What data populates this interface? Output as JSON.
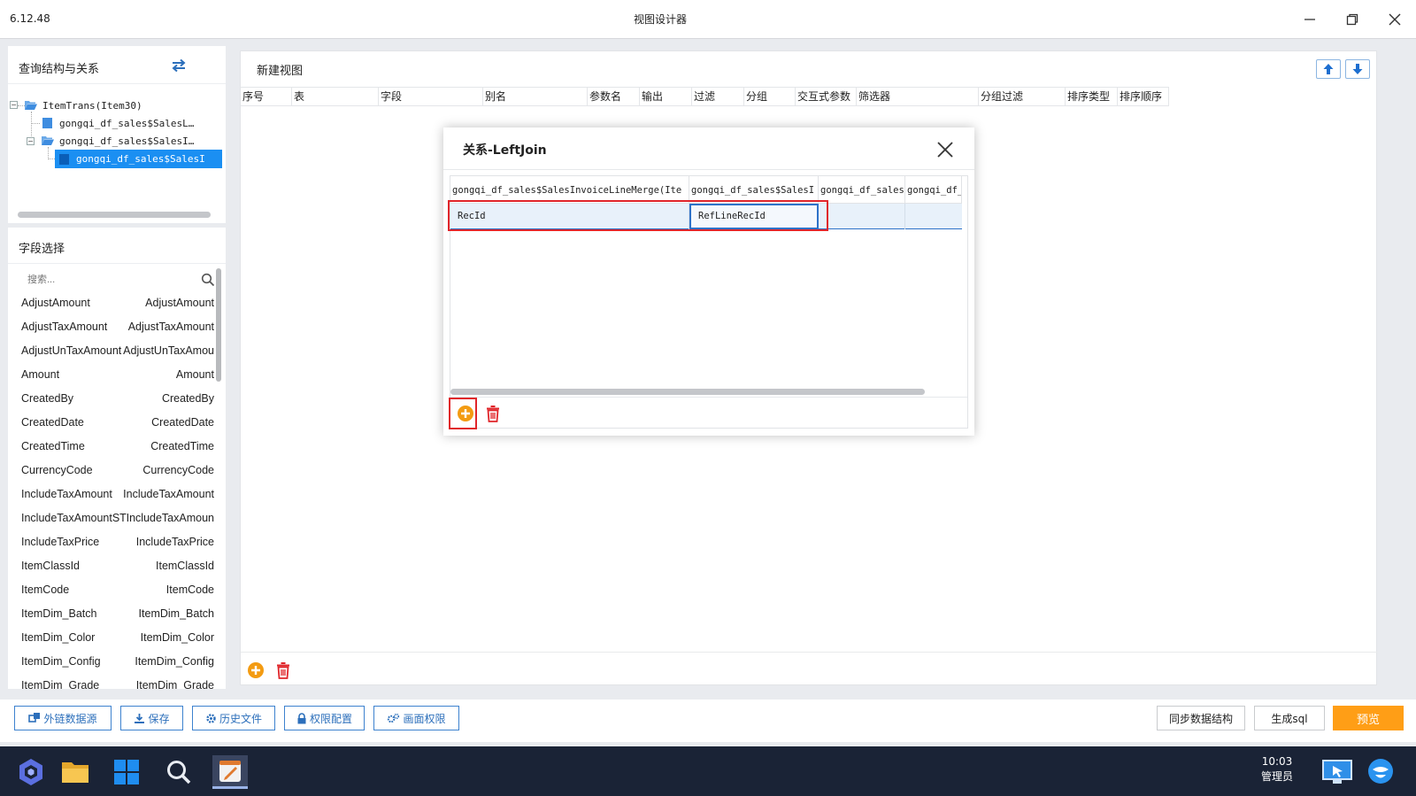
{
  "window": {
    "version": "6.12.48",
    "title": "视图设计器"
  },
  "query_panel": {
    "title": "查询结构与关系",
    "tree": [
      {
        "label": "ItemTrans(Item30)",
        "level": 0
      },
      {
        "label": "gongqi_df_sales$SalesL…",
        "level": 1
      },
      {
        "label": "gongqi_df_sales$SalesI…",
        "level": 1
      },
      {
        "label": "gongqi_df_sales$SalesI",
        "level": 2,
        "selected": true
      }
    ]
  },
  "field_panel": {
    "title": "字段选择",
    "search_placeholder": "搜索...",
    "fields": [
      {
        "name": "AdjustAmount",
        "alias": "AdjustAmount"
      },
      {
        "name": "AdjustTaxAmount",
        "alias": "AdjustTaxAmount"
      },
      {
        "name": "AdjustUnTaxAmount",
        "alias": "AdjustUnTaxAmou"
      },
      {
        "name": "Amount",
        "alias": "Amount"
      },
      {
        "name": "CreatedBy",
        "alias": "CreatedBy"
      },
      {
        "name": "CreatedDate",
        "alias": "CreatedDate"
      },
      {
        "name": "CreatedTime",
        "alias": "CreatedTime"
      },
      {
        "name": "CurrencyCode",
        "alias": "CurrencyCode"
      },
      {
        "name": "IncludeTaxAmount",
        "alias": "IncludeTaxAmount"
      },
      {
        "name": "IncludeTaxAmountST",
        "alias": "IncludeTaxAmoun"
      },
      {
        "name": "IncludeTaxPrice",
        "alias": "IncludeTaxPrice"
      },
      {
        "name": "ItemClassId",
        "alias": "ItemClassId"
      },
      {
        "name": "ItemCode",
        "alias": "ItemCode"
      },
      {
        "name": "ItemDim_Batch",
        "alias": "ItemDim_Batch"
      },
      {
        "name": "ItemDim_Color",
        "alias": "ItemDim_Color"
      },
      {
        "name": "ItemDim_Config",
        "alias": "ItemDim_Config"
      },
      {
        "name": "ItemDim_Grade",
        "alias": "ItemDim_Grade"
      }
    ]
  },
  "main": {
    "title": "新建视图",
    "columns": [
      "序号",
      "表",
      "字段",
      "别名",
      "参数名",
      "输出",
      "过滤",
      "分组",
      "交互式参数",
      "筛选器",
      "分组过滤",
      "排序类型",
      "排序顺序"
    ]
  },
  "dialog": {
    "title": "关系-LeftJoin",
    "columns": [
      "gongqi_df_sales$SalesInvoiceLineMerge(Ite",
      "gongqi_df_sales$SalesI",
      "gongqi_df_sales",
      "gongqi_df_"
    ],
    "rows": [
      [
        "RecId",
        "RefLineRecId",
        "",
        ""
      ]
    ]
  },
  "toolbar": {
    "buttons": [
      "外链数据源",
      "保存",
      "历史文件",
      "权限配置",
      "画面权限"
    ],
    "sync": "同步数据结构",
    "gen_sql": "生成sql",
    "preview": "预览"
  },
  "taskbar": {
    "time": "10:03",
    "user": "管理员"
  },
  "colors": {
    "accent_blue": "#2e72c8",
    "highlight_red": "#e0252a",
    "preview_orange": "#ff9e16",
    "add_orange": "#f39b12",
    "delete_red": "#e0252a"
  }
}
